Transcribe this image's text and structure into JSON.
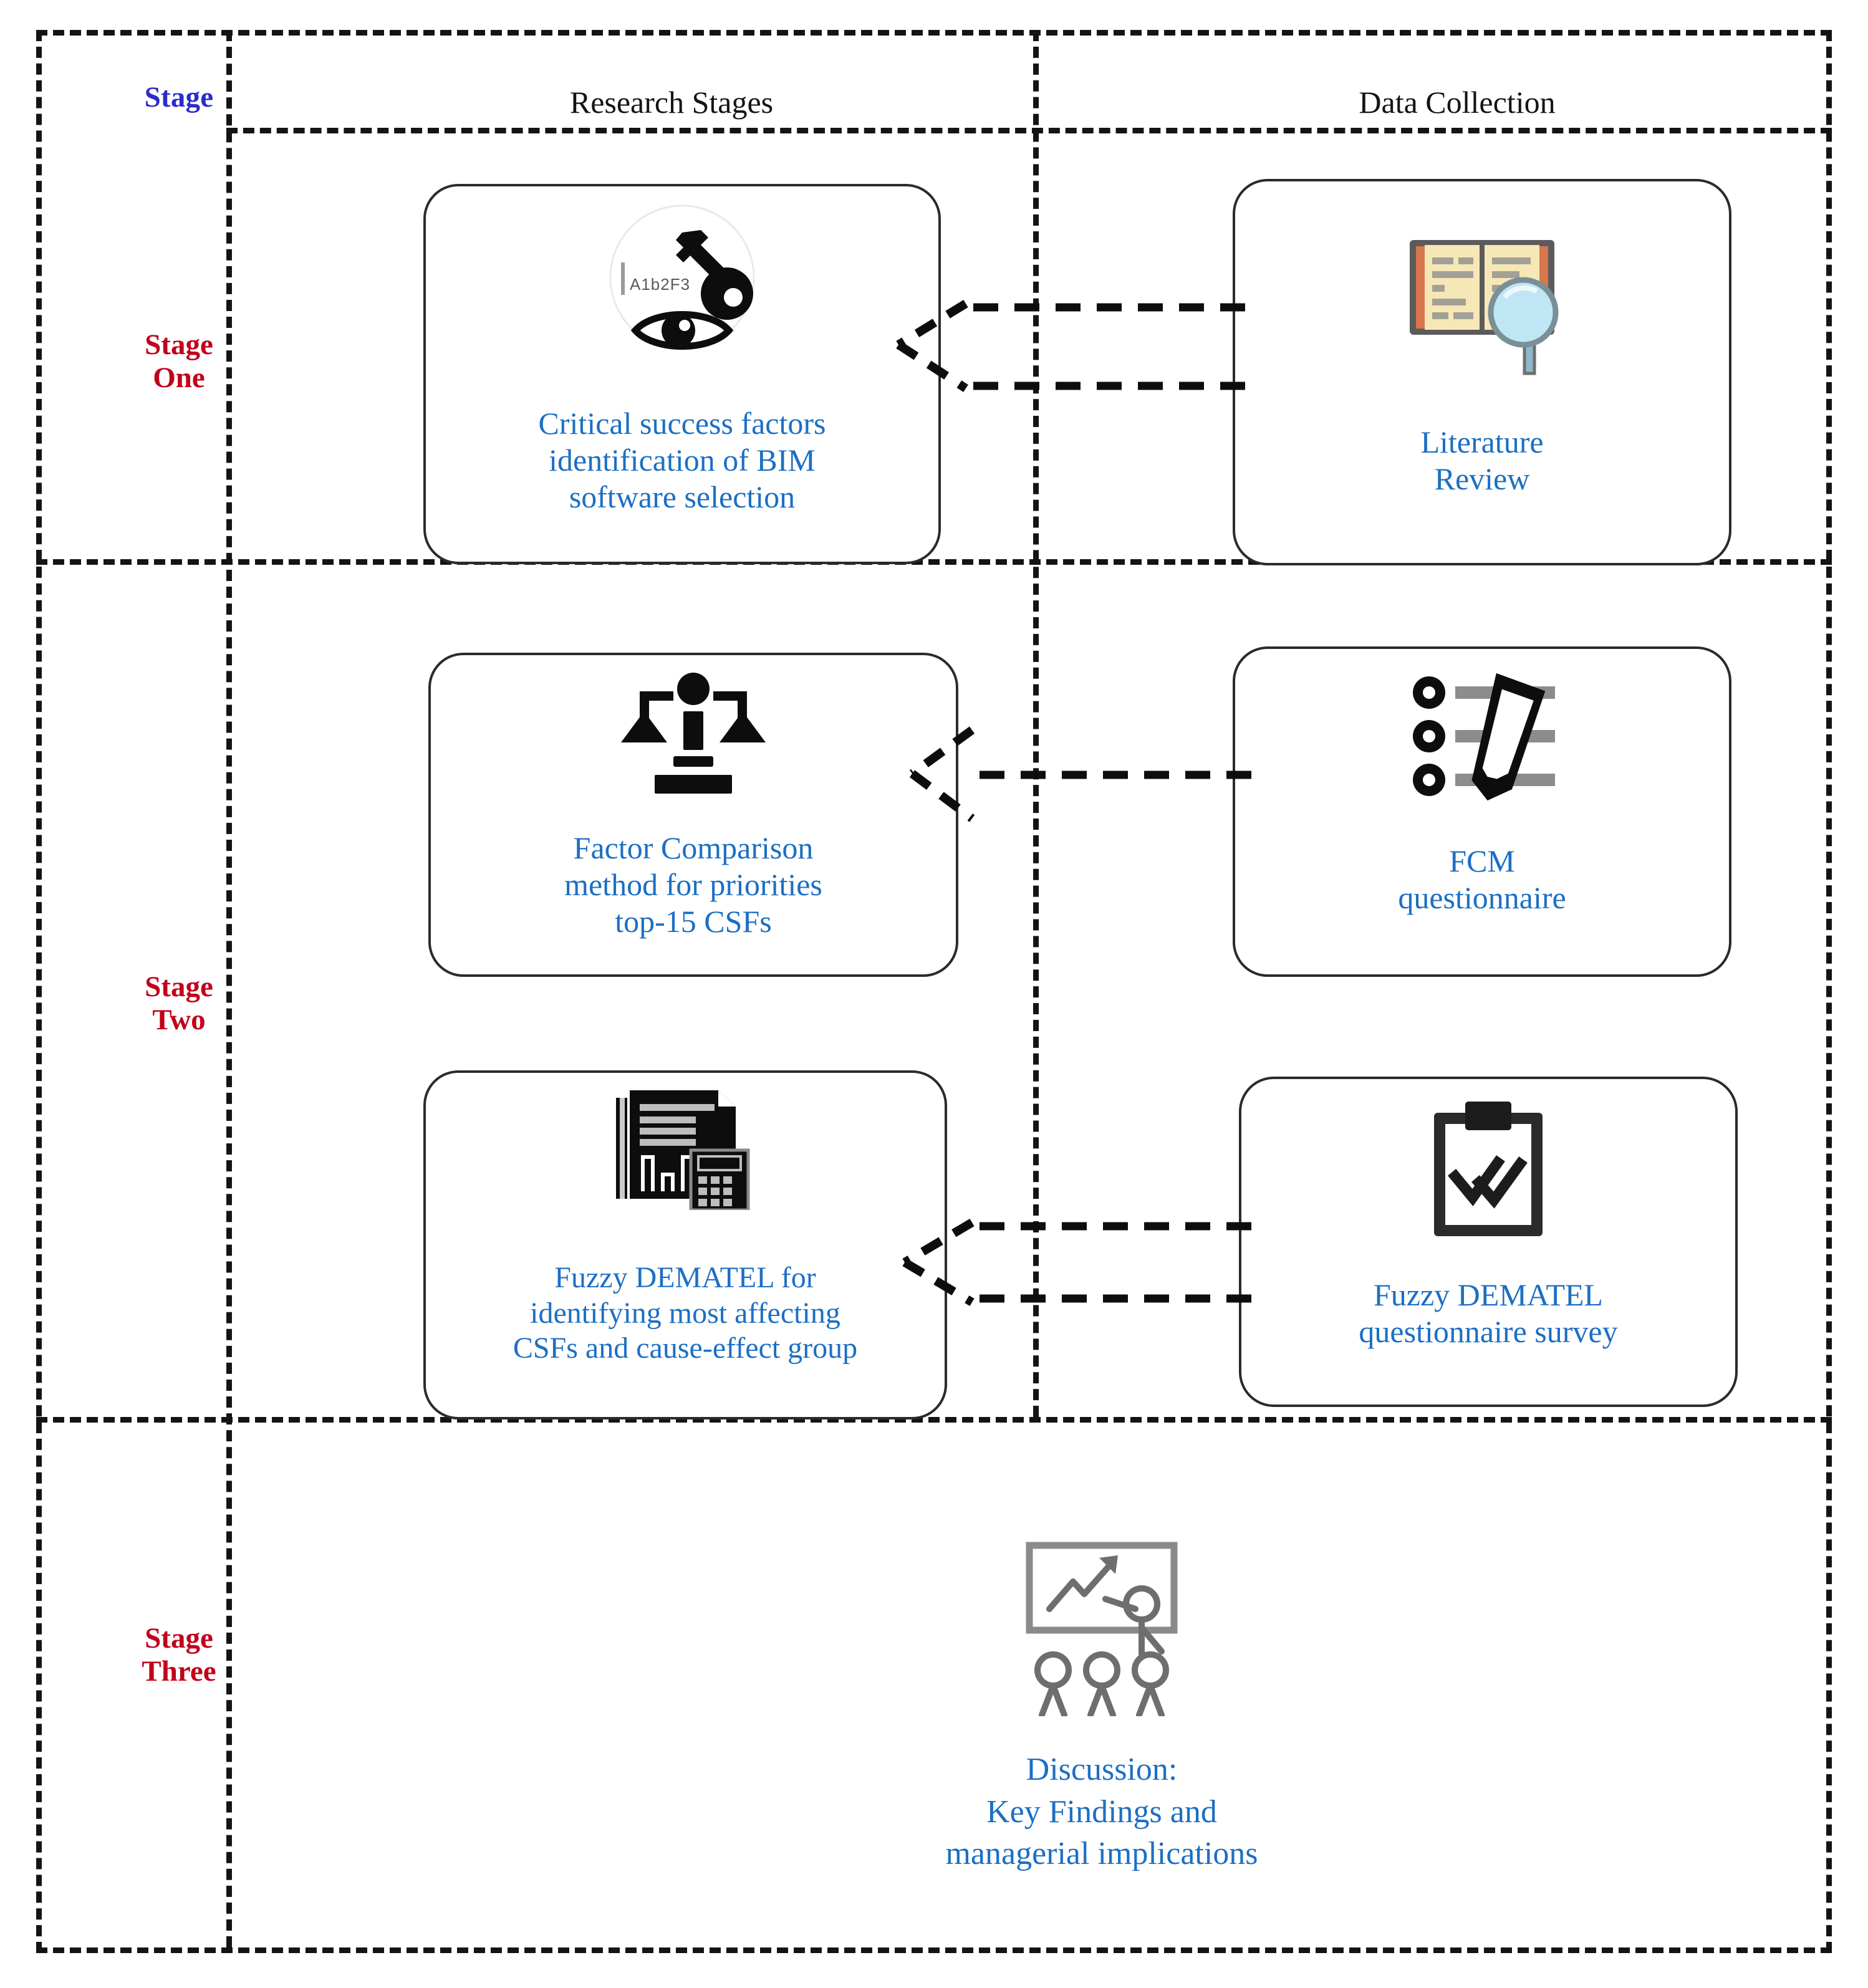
{
  "header": {
    "stage_column_label": "Stage",
    "research_stages_label": "Research Stages",
    "data_collection_label": "Data Collection"
  },
  "colors": {
    "stage_header": "#2c2ccb",
    "stage_label": "#c2001b",
    "node_text": "#1c6fc4",
    "frame": "#141414",
    "node_border": "#2b2b2b"
  },
  "stages": [
    {
      "id": "one",
      "label_line1": "Stage",
      "label_line2": "One"
    },
    {
      "id": "two",
      "label_line1": "Stage",
      "label_line2": "Two"
    },
    {
      "id": "three",
      "label_line1": "Stage",
      "label_line2": "Three"
    }
  ],
  "nodes": {
    "csf": {
      "icon": "key-eye-password-icon",
      "icon_caption": "A1b2F3",
      "line1": "Critical success factors",
      "line2": "identification of BIM",
      "line3": "software selection"
    },
    "literature_review": {
      "icon": "book-magnifier-icon",
      "line1": "Literature",
      "line2": "Review"
    },
    "factor_comparison": {
      "icon": "balance-scales-icon",
      "line1": "Factor Comparison",
      "line2": "method for priorities",
      "line3": "top-15 CSFs"
    },
    "fcm_questionnaire": {
      "icon": "survey-pencil-icon",
      "line1": "FCM",
      "line2": "questionnaire"
    },
    "fuzzy_dematel": {
      "icon": "report-calculator-icon",
      "line1": "Fuzzy DEMATEL for",
      "line2": "identifying most affecting",
      "line3": "CSFs and cause-effect group"
    },
    "dematel_survey": {
      "icon": "clipboard-checks-icon",
      "line1": "Fuzzy DEMATEL",
      "line2": "questionnaire survey"
    },
    "discussion": {
      "icon": "presentation-audience-icon",
      "line1": "Discussion:",
      "line2": "Key Findings and",
      "line3": "managerial implications"
    }
  },
  "connectors": [
    {
      "id": "conn-stage-one",
      "from": "literature_review",
      "to": "csf",
      "style": "dashed",
      "direction": "right-to-left"
    },
    {
      "id": "conn-stage-two-a",
      "from": "fcm_questionnaire",
      "to": "factor_comparison",
      "style": "dashed",
      "direction": "right-to-left"
    },
    {
      "id": "conn-stage-two-b",
      "from": "dematel_survey",
      "to": "fuzzy_dematel",
      "style": "dashed",
      "direction": "right-to-left"
    }
  ]
}
